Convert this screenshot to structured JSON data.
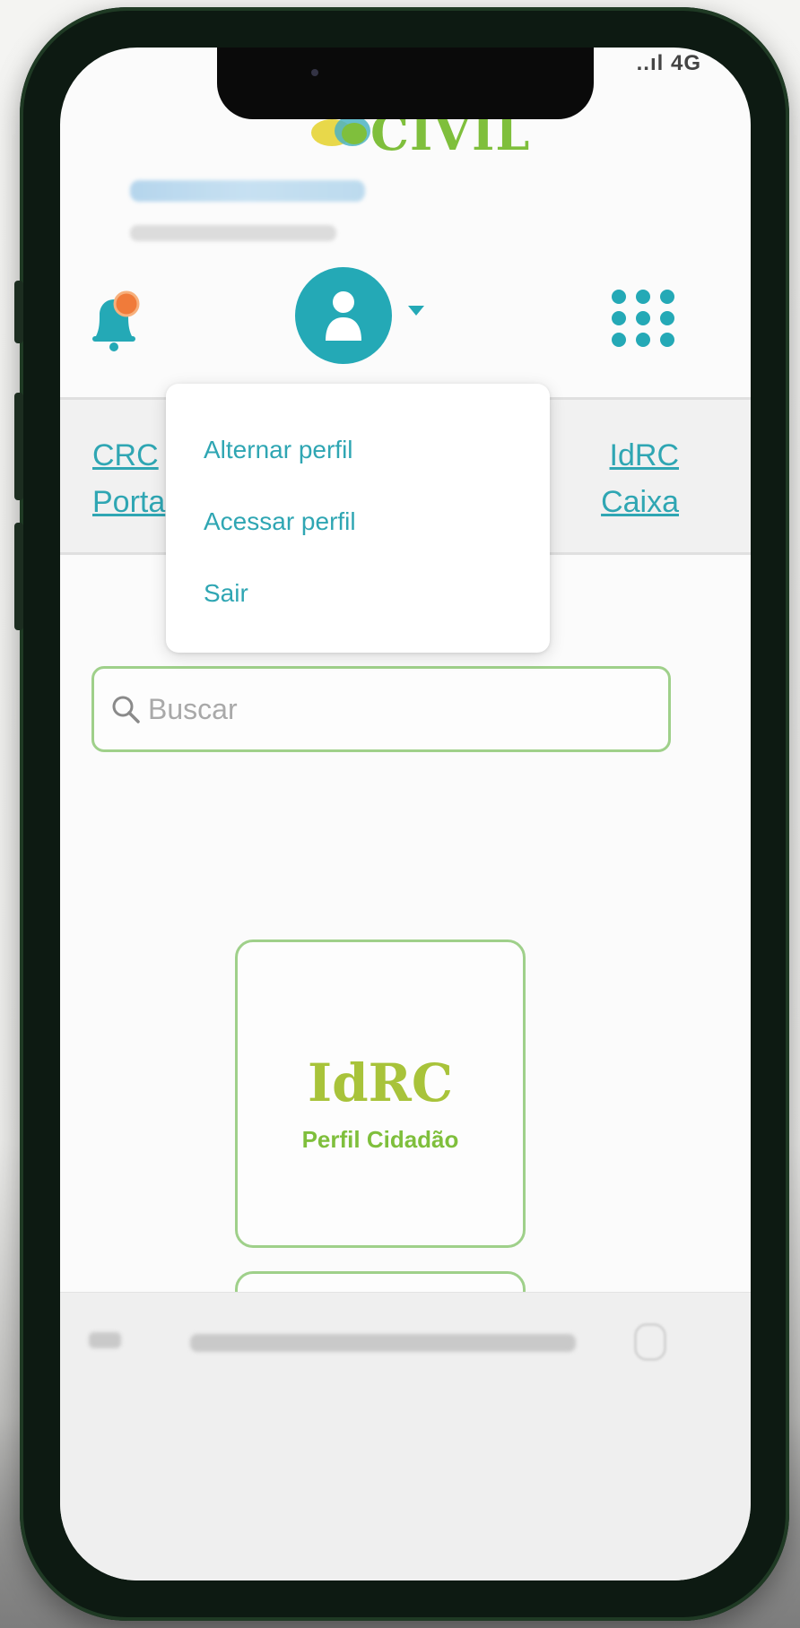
{
  "header": {
    "logo_text": "CIVIL",
    "status_signal": "..ıl 4G"
  },
  "links": {
    "left_line1": "CRC",
    "left_line2": "Porta",
    "right_line1": "IdRC",
    "right_line2": "Caixa"
  },
  "profile_menu": {
    "items": [
      "Alternar perfil",
      "Acessar perfil",
      "Sair"
    ]
  },
  "search": {
    "placeholder": "Buscar"
  },
  "cards": [
    {
      "title": "IdRC",
      "subtitle": "Perfil Cidadão"
    }
  ],
  "colors": {
    "accent_teal": "#24a9b6",
    "accent_green": "#7fbf3c",
    "border_green": "#9fd08a",
    "notification_orange": "#f07b3a"
  },
  "icons": [
    "bell-icon",
    "user-avatar-icon",
    "caret-down-icon",
    "apps-grid-icon",
    "search-icon"
  ]
}
